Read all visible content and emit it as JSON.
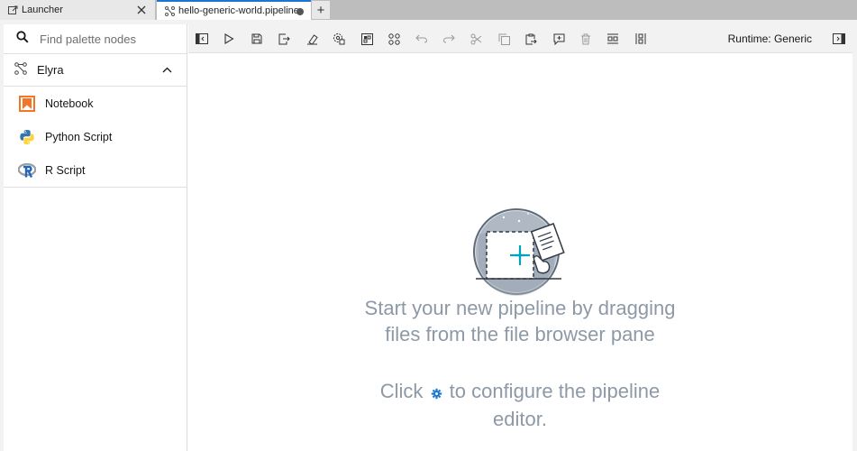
{
  "tabs": [
    {
      "label": "Launcher",
      "icon": "launcher-icon",
      "state": "closable"
    },
    {
      "label": "hello-generic-world.pipeline",
      "icon": "pipeline-icon",
      "state": "unsaved"
    }
  ],
  "new_tab_label": "+",
  "palette": {
    "search_placeholder": "Find palette nodes",
    "category": {
      "label": "Elyra",
      "icon": "pipeline-icon",
      "expanded": true
    },
    "nodes": [
      {
        "label": "Notebook",
        "icon": "notebook-icon"
      },
      {
        "label": "Python Script",
        "icon": "python-icon"
      },
      {
        "label": "R Script",
        "icon": "r-icon"
      }
    ]
  },
  "toolbar": {
    "buttons": [
      "toggle-palette",
      "run",
      "save",
      "export",
      "clear",
      "open-runtimes",
      "open-runtime-images",
      "open-component-catalogs",
      "undo",
      "redo",
      "cut",
      "copy",
      "paste",
      "add-comment",
      "delete",
      "arrange-horizontal",
      "arrange-vertical"
    ],
    "runtime_label": "Runtime: Generic",
    "right_icon": "panel-toggle-icon"
  },
  "canvas": {
    "empty_message": "Start your new pipeline by dragging files from the file browser pane",
    "configure_prefix": "Click",
    "configure_suffix": "to configure the pipeline editor."
  },
  "colors": {
    "accent": "#1976d2",
    "message": "#8d99a6",
    "notebook": "#f37626",
    "illustration": "#8896a4"
  }
}
